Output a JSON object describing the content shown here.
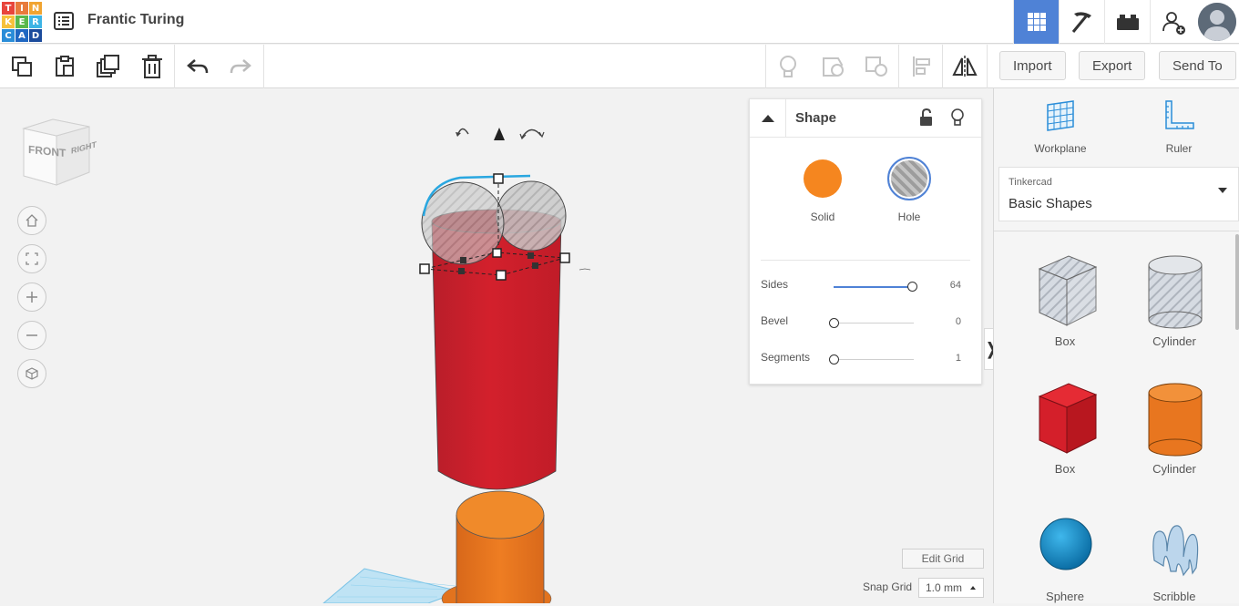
{
  "app": {
    "logo_letters": [
      "T",
      "I",
      "N",
      "K",
      "E",
      "R",
      "C",
      "A",
      "D"
    ],
    "logo_colors": [
      "#e8453c",
      "#e87a3c",
      "#f1a431",
      "#f6c13b",
      "#59b84b",
      "#3db4e5",
      "#2a8dd8",
      "#1f67c2",
      "#1b4b9c"
    ],
    "project_title": "Frantic Turing",
    "accent": "#4f82d6"
  },
  "header": {
    "icons": [
      "grid-view-icon",
      "pickaxe-icon",
      "bricks-icon",
      "add-user-icon",
      "user-avatar"
    ]
  },
  "toolbar": {
    "left_tools": [
      "copy-icon",
      "paste-icon",
      "duplicate-icon",
      "delete-icon",
      "undo-icon",
      "redo-icon"
    ],
    "right_tools": [
      "lightbulb-icon",
      "group-icon",
      "ungroup-icon",
      "align-icon",
      "mirror-icon"
    ],
    "import_label": "Import",
    "export_label": "Export",
    "send_to_label": "Send To"
  },
  "viewcube": {
    "front_label": "FRONT",
    "right_label": "RIGHT"
  },
  "inspector": {
    "title": "Shape",
    "solid_label": "Solid",
    "hole_label": "Hole",
    "solid_color": "#f5861f",
    "params": [
      {
        "label": "Sides",
        "value": "64",
        "fraction": 0.98
      },
      {
        "label": "Bevel",
        "value": "0",
        "fraction": 0.0
      },
      {
        "label": "Segments",
        "value": "1",
        "fraction": 0.0
      }
    ]
  },
  "sidebar": {
    "workplane_label": "Workplane",
    "ruler_label": "Ruler",
    "library_brand": "Tinkercad",
    "library_name": "Basic Shapes",
    "shapes": [
      {
        "label": "Box"
      },
      {
        "label": "Cylinder"
      },
      {
        "label": "Box"
      },
      {
        "label": "Cylinder"
      },
      {
        "label": "Sphere"
      },
      {
        "label": "Scribble"
      }
    ]
  },
  "grid": {
    "edit_grid_label": "Edit Grid",
    "snap_grid_label": "Snap Grid",
    "snap_grid_value": "1.0 mm"
  }
}
